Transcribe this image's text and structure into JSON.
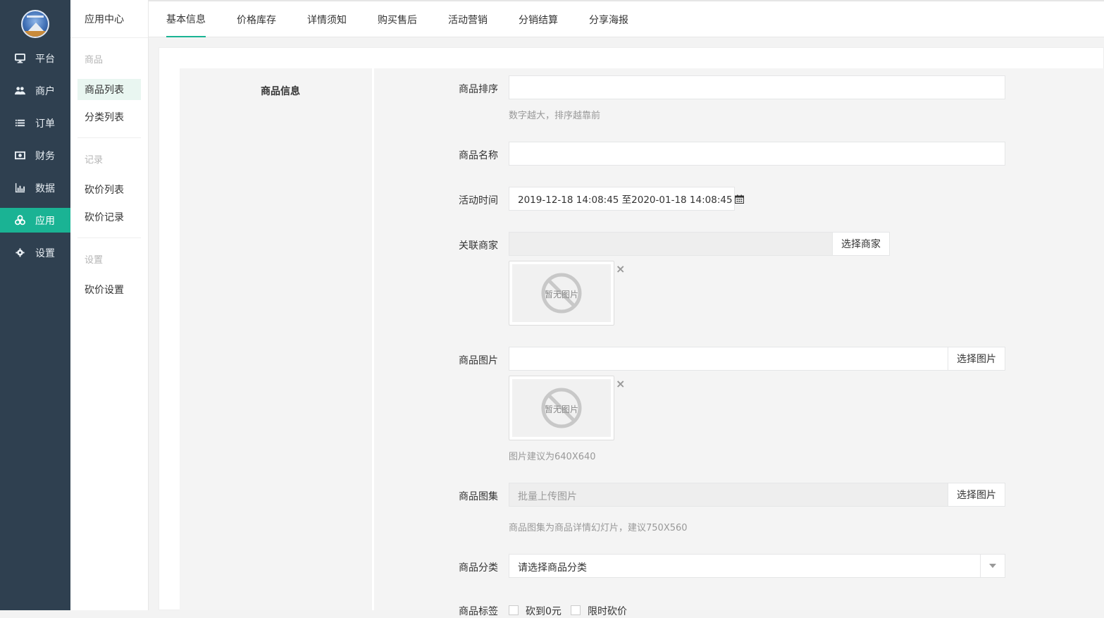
{
  "nav": {
    "items": [
      {
        "label": "平台",
        "icon": "monitor-icon"
      },
      {
        "label": "商户",
        "icon": "users-icon"
      },
      {
        "label": "订单",
        "icon": "list-icon"
      },
      {
        "label": "财务",
        "icon": "money-icon"
      },
      {
        "label": "数据",
        "icon": "bar-chart-icon"
      },
      {
        "label": "应用",
        "icon": "cubes-icon"
      },
      {
        "label": "设置",
        "icon": "gear-icon"
      }
    ],
    "active_color": "#1ab394",
    "bg_color": "#2f4050"
  },
  "subnav": {
    "title": "应用中心",
    "groups": [
      {
        "label": "商品",
        "items": [
          "商品列表",
          "分类列表"
        ]
      },
      {
        "label": "记录",
        "items": [
          "砍价列表",
          "砍价记录"
        ]
      },
      {
        "label": "设置",
        "items": [
          "砍价设置"
        ]
      }
    ]
  },
  "tabs": [
    "基本信息",
    "价格库存",
    "详情须知",
    "购买售后",
    "活动营销",
    "分销结算",
    "分享海报"
  ],
  "form": {
    "section": "商品信息",
    "sort_label": "商品排序",
    "sort_hint": "数字越大，排序越靠前",
    "name_label": "商品名称",
    "time_label": "活动时间",
    "time_value": "2019-12-18 14:08:45 至2020-01-18 14:08:45",
    "merchant_label": "关联商家",
    "merchant_button": "选择商家",
    "no_image": "暂无图片",
    "image_label": "商品图片",
    "image_button": "选择图片",
    "image_hint": "图片建议为640X640",
    "gallery_label": "商品图集",
    "gallery_placeholder": "批量上传图片",
    "gallery_button": "选择图片",
    "gallery_hint": "商品图集为商品详情幻灯片，建议750X560",
    "category_label": "商品分类",
    "category_value": "请选择商品分类",
    "tags_label": "商品标签",
    "tag_options": [
      "砍到0元",
      "限时砍价"
    ]
  }
}
